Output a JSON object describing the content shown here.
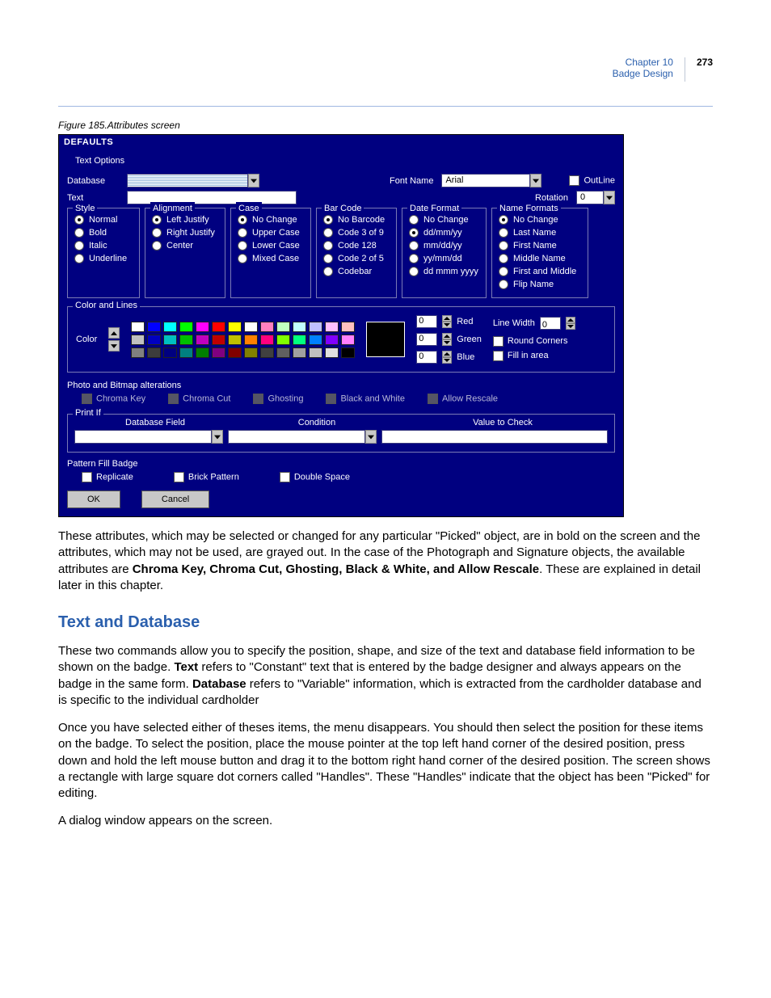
{
  "header": {
    "chapter": "Chapter 10",
    "section": "Badge Design",
    "page": "273"
  },
  "caption": "Figure 185.Attributes screen",
  "dialog": {
    "title": "DEFAULTS",
    "text_options_label": "Text Options",
    "database_label": "Database",
    "text_label": "Text",
    "fontname_label": "Font Name",
    "fontname_value": "Arial",
    "outline_label": "OutLine",
    "rotation_label": "Rotation",
    "rotation_value": "0",
    "style": {
      "legend": "Style",
      "items": [
        "Normal",
        "Bold",
        "Italic",
        "Underline"
      ],
      "selected": 0
    },
    "alignment": {
      "legend": "Alignment",
      "items": [
        "Left Justify",
        "Right Justify",
        "Center"
      ],
      "selected": 0
    },
    "case": {
      "legend": "Case",
      "items": [
        "No Change",
        "Upper Case",
        "Lower Case",
        "Mixed Case"
      ],
      "selected": 0
    },
    "barcode": {
      "legend": "Bar Code",
      "items": [
        "No Barcode",
        "Code 3 of 9",
        "Code 128",
        "Code 2 of 5",
        "Codebar"
      ],
      "selected": 0
    },
    "dateformat": {
      "legend": "Date Format",
      "items": [
        "No Change",
        "dd/mm/yy",
        "mm/dd/yy",
        "yy/mm/dd",
        "dd mmm yyyy"
      ],
      "selected": 1
    },
    "nameformats": {
      "legend": "Name Formats",
      "items": [
        "No Change",
        "Last Name",
        "First Name",
        "Middle Name",
        "First and Middle",
        "Flip Name"
      ],
      "selected": 0
    },
    "colorlines": {
      "legend": "Color and Lines",
      "color_label": "Color",
      "palette": [
        "#ffffff",
        "#0000ff",
        "#00ffff",
        "#00ff00",
        "#ff00ff",
        "#ff0000",
        "#ffff00",
        "#ffffff",
        "#ff80c0",
        "#c0ffc0",
        "#c0ffff",
        "#c0c0ff",
        "#ffc0ff",
        "#ffc0c0",
        "#c0c0c0",
        "#0000c0",
        "#00c0c0",
        "#00c000",
        "#c000c0",
        "#c00000",
        "#c0c000",
        "#ff8000",
        "#ff0080",
        "#80ff00",
        "#00ff80",
        "#0080ff",
        "#8000ff",
        "#ff80ff",
        "#808080",
        "#3c3c3c",
        "#000080",
        "#008080",
        "#008000",
        "#800080",
        "#800000",
        "#808000",
        "#404040",
        "#606060",
        "#a0a0a0",
        "#c0c0c0",
        "#e0e0e0",
        "#000000"
      ],
      "rgb": {
        "red_label": "Red",
        "green_label": "Green",
        "blue_label": "Blue",
        "red": "0",
        "green": "0",
        "blue": "0"
      },
      "linewidth_label": "Line Width",
      "linewidth_value": "0",
      "round_corners_label": "Round Corners",
      "fill_area_label": "Fill in area"
    },
    "photo": {
      "label": "Photo and Bitmap alterations",
      "chromakey": "Chroma Key",
      "chromacut": "Chroma Cut",
      "ghosting": "Ghosting",
      "bw": "Black and White",
      "allow_rescale": "Allow Rescale"
    },
    "printif": {
      "legend": "Print If",
      "dbfield_label": "Database Field",
      "condition_label": "Condition",
      "value_label": "Value to Check"
    },
    "pattern": {
      "label": "Pattern Fill Badge",
      "replicate": "Replicate",
      "brick": "Brick Pattern",
      "double": "Double Space"
    },
    "ok_label": "OK",
    "cancel_label": "Cancel"
  },
  "body": {
    "p1a": "These attributes, which may be selected or changed for any particular \"Picked\" object, are in bold on the screen and the attributes, which may not be used, are grayed out. In the case of the Photograph and Signature objects, the available attributes are ",
    "p1b": "Chroma Key, Chroma Cut, Ghosting, Black & White, and Allow Rescale",
    "p1c": ". These are explained in detail later in this chapter.",
    "h2": "Text and Database",
    "p2a": "These two commands allow you to specify the position, shape, and size of the text and database field information to be shown on the badge. ",
    "p2b": "Text",
    "p2c": " refers to \"Constant\" text that is entered by the badge designer and always appears on the badge in the same form. ",
    "p2d": "Database",
    "p2e": " refers to \"Variable\" information, which is extracted from the cardholder database and is specific to the individual cardholder",
    "p3": "Once you have selected either of theses items, the menu disappears. You should then select the position for these items on the badge. To select the position, place the mouse pointer at the top left hand corner of the desired position, press down and hold the left mouse button and drag it to the bottom right hand corner of the desired position. The screen shows a rectangle with large square dot corners called \"Handles\". These \"Handles\" indicate that the object has been \"Picked\" for editing.",
    "p4": "A dialog window appears on the screen."
  }
}
